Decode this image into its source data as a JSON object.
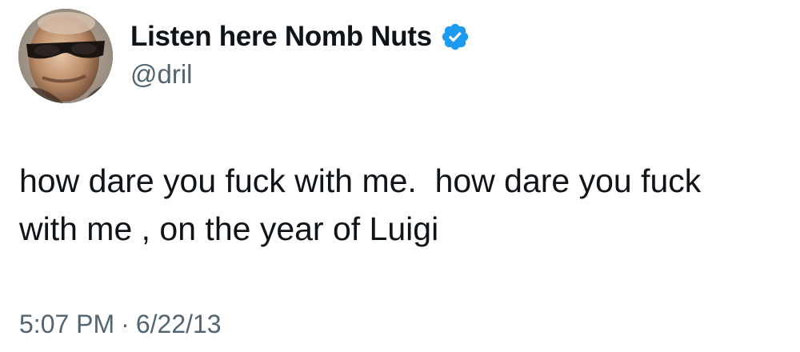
{
  "author": {
    "display_name": "Listen here Nomb Nuts",
    "handle": "@dril",
    "verified": true,
    "avatar_icon": "user-avatar-sunglasses",
    "verified_icon": "verified-badge-icon"
  },
  "tweet": {
    "text": "how dare you fuck with me.  how dare you fuck\nwith me , on the year of Luigi",
    "time": "5:07 PM",
    "separator": "·",
    "date": "6/22/13"
  },
  "colors": {
    "text_primary": "#0f1419",
    "text_secondary": "#536471",
    "verified_blue": "#1d9bf0",
    "background": "#ffffff"
  }
}
